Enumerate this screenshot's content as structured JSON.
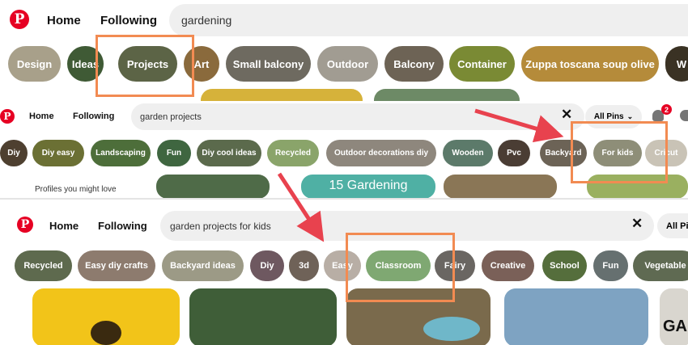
{
  "brand_color": "#e60023",
  "highlight_color": "#f28b52",
  "arrow_color": "#e8424e",
  "screens": [
    {
      "nav": {
        "home": "Home",
        "following": "Following"
      },
      "search": {
        "query": "gardening"
      },
      "chips": [
        {
          "label": "Design",
          "color": "#a8a08a"
        },
        {
          "label": "Ideas",
          "color": "#3f5a35"
        },
        {
          "label": "Projects",
          "color": "#5c6446"
        },
        {
          "label": "Art",
          "color": "#8a6a3c"
        },
        {
          "label": "Small balcony",
          "color": "#6e6a60"
        },
        {
          "label": "Outdoor",
          "color": "#a19c92"
        },
        {
          "label": "Balcony",
          "color": "#6d6355"
        },
        {
          "label": "Container",
          "color": "#7a8a34"
        },
        {
          "label": "Zuppa toscana soup olive",
          "color": "#b58b3a"
        },
        {
          "label": "W",
          "color": "#3a3224"
        }
      ]
    },
    {
      "nav": {
        "home": "Home",
        "following": "Following"
      },
      "search": {
        "query": "garden projects"
      },
      "filter": "All Pins",
      "notification_count": "2",
      "sidebar_text": "Profiles you might love",
      "tile_text": "15 Gardening",
      "chips": [
        {
          "label": "Diy",
          "color": "#4e4030"
        },
        {
          "label": "Diy easy",
          "color": "#6b7034"
        },
        {
          "label": "Landscaping",
          "color": "#4d6e3a"
        },
        {
          "label": "Fun",
          "color": "#3f6640"
        },
        {
          "label": "Diy cool ideas",
          "color": "#5b6a4c"
        },
        {
          "label": "Recycled",
          "color": "#8aa46a"
        },
        {
          "label": "Outdoor decorations diy",
          "color": "#8e877d"
        },
        {
          "label": "Wooden",
          "color": "#5c7a6a"
        },
        {
          "label": "Pvc",
          "color": "#4a3d34"
        },
        {
          "label": "Backyard",
          "color": "#6c6356"
        },
        {
          "label": "For kids",
          "color": "#8e8e78"
        },
        {
          "label": "Cricut",
          "color": "#c9c3b6"
        }
      ]
    },
    {
      "nav": {
        "home": "Home",
        "following": "Following"
      },
      "search": {
        "query": "garden projects for kids"
      },
      "filter": "All Pi",
      "chips": [
        {
          "label": "Recycled",
          "color": "#5e6a4e"
        },
        {
          "label": "Easy diy crafts",
          "color": "#8d7b6e"
        },
        {
          "label": "Backyard ideas",
          "color": "#9c9a86"
        },
        {
          "label": "Diy",
          "color": "#6e5860"
        },
        {
          "label": "3d",
          "color": "#6f6258"
        },
        {
          "label": "Easy",
          "color": "#b8aea5"
        },
        {
          "label": "Classroom",
          "color": "#7fa872"
        },
        {
          "label": "Fairy",
          "color": "#6a6662"
        },
        {
          "label": "Creative",
          "color": "#7a6058"
        },
        {
          "label": "School",
          "color": "#556e3c"
        },
        {
          "label": "Fun",
          "color": "#667070"
        },
        {
          "label": "Vegetable",
          "color": "#5f6a52"
        }
      ],
      "thumb_text": "GA"
    }
  ]
}
